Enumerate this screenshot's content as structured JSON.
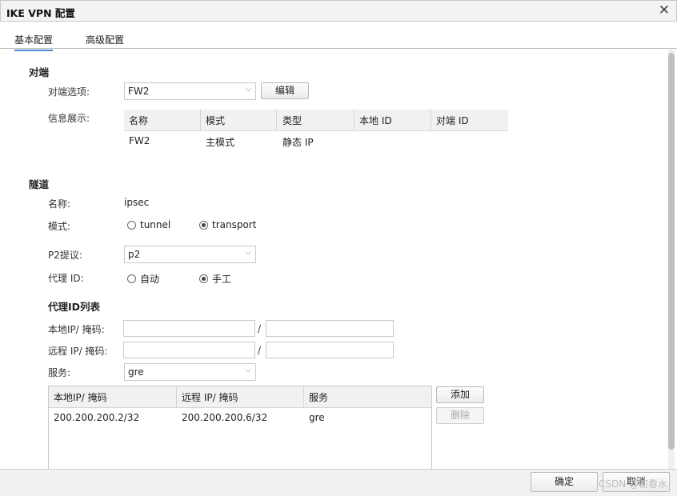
{
  "window": {
    "title": "IKE VPN 配置",
    "close_icon": "close-icon"
  },
  "tabs": [
    {
      "label": "基本配置",
      "active": true
    },
    {
      "label": "高级配置",
      "active": false
    }
  ],
  "peer": {
    "section_title": "对端",
    "option_label": "对端选项:",
    "option_value": "FW2",
    "edit_label": "编辑",
    "info_label": "信息展示:",
    "table": {
      "columns": [
        "名称",
        "模式",
        "类型",
        "本地 ID",
        "对端 ID"
      ],
      "rows": [
        [
          "FW2",
          "主模式",
          "静态 IP",
          "",
          ""
        ]
      ]
    }
  },
  "tunnel": {
    "section_title": "隧道",
    "name_label": "名称:",
    "name_value": "ipsec",
    "mode_label": "模式:",
    "mode_options": [
      {
        "label": "tunnel",
        "selected": false
      },
      {
        "label": "transport",
        "selected": true
      }
    ],
    "p2_label": "P2提议:",
    "p2_value": "p2",
    "proxy_label": "代理 ID:",
    "proxy_options": [
      {
        "label": "自动",
        "selected": false
      },
      {
        "label": "手工",
        "selected": true
      }
    ]
  },
  "proxy_list": {
    "section_title": "代理ID列表",
    "local_label": "本地IP/ 掩码:",
    "remote_label": "远程 IP/ 掩码:",
    "slash": "/",
    "local_ip": "",
    "local_mask": "",
    "remote_ip": "",
    "remote_mask": "",
    "service_label": "服务:",
    "service_value": "gre",
    "add_label": "添加",
    "delete_label": "删除",
    "table": {
      "columns": [
        "本地IP/ 掩码",
        "远程 IP/ 掩码",
        "服务"
      ],
      "rows": [
        [
          "200.200.200.2/32",
          "200.200.200.6/32",
          "gre"
        ]
      ]
    }
  },
  "footer": {
    "ok_label": "确定",
    "cancel_label": "取消",
    "watermark": "CSDN @初春水"
  }
}
